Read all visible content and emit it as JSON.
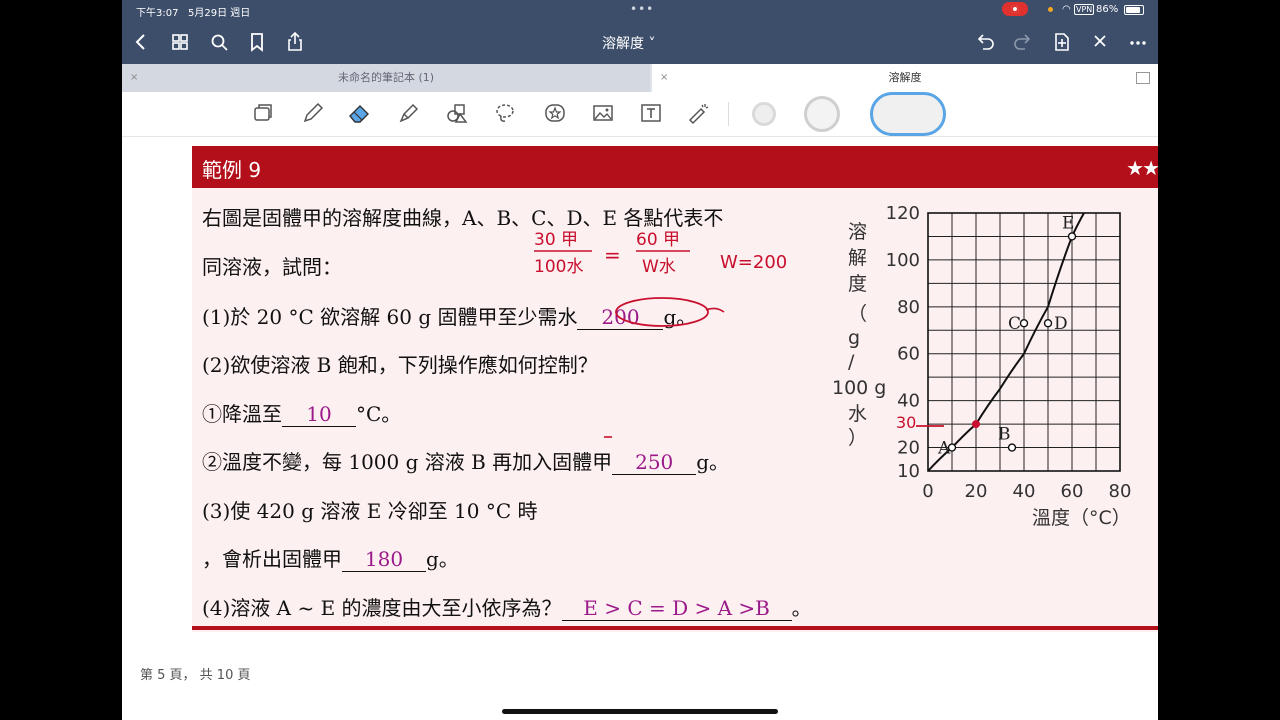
{
  "status": {
    "time": "下午3:07",
    "date": "5月29日 週日",
    "vpn": "VPN",
    "battery": "86%"
  },
  "nav": {
    "doc_title": "溶解度 ˅"
  },
  "tabs": [
    {
      "label": "未命名的筆記本 (1)",
      "close": "×"
    },
    {
      "label": "溶解度",
      "close": "×"
    }
  ],
  "toolbar": {
    "tools": [
      "page-tool",
      "pen",
      "eraser",
      "highlighter",
      "shapes",
      "lasso",
      "sticker",
      "image",
      "text",
      "laser-pointer"
    ],
    "colors": [
      "#d9d9d9",
      "#cfcfcf",
      "#5aa5e6"
    ]
  },
  "example": {
    "title": "範例 9",
    "stars": "★★"
  },
  "question": {
    "intro_1": "右圖是固體甲的溶解度曲線，A、B、C、D、E 各點代表不",
    "intro_2": "同溶液，試問：",
    "q1_text": "(1)於 20 °C 欲溶解 60 g 固體甲至少需水",
    "q1_answer": "200",
    "q1_unit": "g。",
    "q2_text": "(2)欲使溶液 B 飽和，下列操作應如何控制？",
    "q2a_text": "①降溫至",
    "q2a_answer": "10",
    "q2a_unit": "°C。",
    "q2b_text": "②溫度不變，每 1000 g 溶液 B 再加入固體甲",
    "q2b_answer": "250",
    "q2b_unit": "g。",
    "q3_text": "(3)使 420 g 溶液 E 冷卻至 10 °C 時",
    "q3_text2": "，會析出固體甲",
    "q3_answer": "180",
    "q3_unit": "g。",
    "q4_text": "(4)溶液 A ~ E 的濃度由大至小依序為？",
    "q4_answer": "E > C = D > A >B",
    "q4_unit": "。"
  },
  "handwriting": {
    "frac1_num": "30 甲",
    "frac1_den": "100水",
    "eq": "=",
    "frac2_num": "60 甲",
    "frac2_den": "W水",
    "result": "W=200",
    "mark_30": "30"
  },
  "chart_data": {
    "type": "line",
    "ylabel": "溶解度（g / 100 g 水）",
    "xlabel": "溫度（°C）",
    "xlim": [
      0,
      80
    ],
    "ylim": [
      10,
      120
    ],
    "x_ticks": [
      "0",
      "20",
      "40",
      "60",
      "80"
    ],
    "y_ticks": [
      "10",
      "20",
      "40",
      "60",
      "80",
      "100",
      "120"
    ],
    "grid": true,
    "curve": {
      "x": [
        0,
        10,
        20,
        30,
        40,
        50,
        60,
        65
      ],
      "y": [
        10,
        20,
        30,
        45,
        60,
        80,
        110,
        120
      ]
    },
    "points": [
      {
        "label": "A",
        "x": 10,
        "y": 20
      },
      {
        "label": "B",
        "x": 35,
        "y": 20
      },
      {
        "label": "C",
        "x": 40,
        "y": 73
      },
      {
        "label": "D",
        "x": 50,
        "y": 73
      },
      {
        "label": "E",
        "x": 60,
        "y": 110
      }
    ]
  },
  "footer": {
    "page_label": "第 5 頁， 共 10 頁"
  }
}
